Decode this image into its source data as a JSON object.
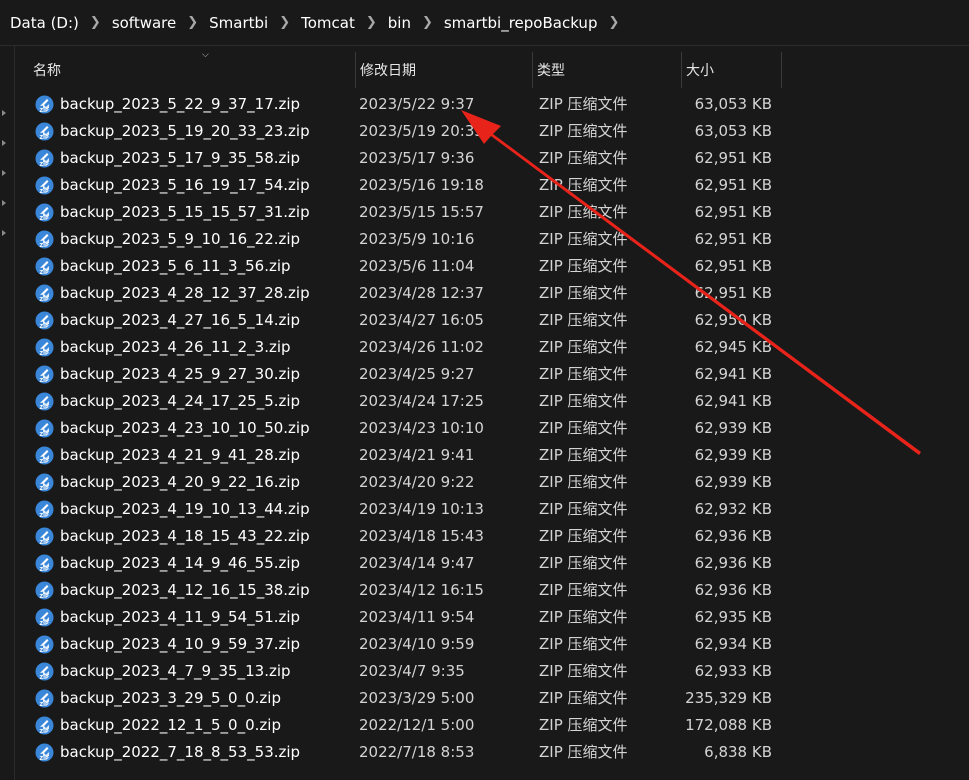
{
  "breadcrumb": [
    {
      "label": "Data (D:)"
    },
    {
      "label": "software"
    },
    {
      "label": "Smartbi"
    },
    {
      "label": "Tomcat"
    },
    {
      "label": "bin"
    },
    {
      "label": "smartbi_repoBackup"
    }
  ],
  "columns": {
    "name": "名称",
    "date": "修改日期",
    "type": "类型",
    "size": "大小"
  },
  "files": [
    {
      "name": "backup_2023_5_22_9_37_17.zip",
      "date": "2023/5/22 9:37",
      "type": "ZIP 压缩文件",
      "size": "63,053 KB"
    },
    {
      "name": "backup_2023_5_19_20_33_23.zip",
      "date": "2023/5/19 20:33",
      "type": "ZIP 压缩文件",
      "size": "63,053 KB"
    },
    {
      "name": "backup_2023_5_17_9_35_58.zip",
      "date": "2023/5/17 9:36",
      "type": "ZIP 压缩文件",
      "size": "62,951 KB"
    },
    {
      "name": "backup_2023_5_16_19_17_54.zip",
      "date": "2023/5/16 19:18",
      "type": "ZIP 压缩文件",
      "size": "62,951 KB"
    },
    {
      "name": "backup_2023_5_15_15_57_31.zip",
      "date": "2023/5/15 15:57",
      "type": "ZIP 压缩文件",
      "size": "62,951 KB"
    },
    {
      "name": "backup_2023_5_9_10_16_22.zip",
      "date": "2023/5/9 10:16",
      "type": "ZIP 压缩文件",
      "size": "62,951 KB"
    },
    {
      "name": "backup_2023_5_6_11_3_56.zip",
      "date": "2023/5/6 11:04",
      "type": "ZIP 压缩文件",
      "size": "62,951 KB"
    },
    {
      "name": "backup_2023_4_28_12_37_28.zip",
      "date": "2023/4/28 12:37",
      "type": "ZIP 压缩文件",
      "size": "62,951 KB"
    },
    {
      "name": "backup_2023_4_27_16_5_14.zip",
      "date": "2023/4/27 16:05",
      "type": "ZIP 压缩文件",
      "size": "62,950 KB"
    },
    {
      "name": "backup_2023_4_26_11_2_3.zip",
      "date": "2023/4/26 11:02",
      "type": "ZIP 压缩文件",
      "size": "62,945 KB"
    },
    {
      "name": "backup_2023_4_25_9_27_30.zip",
      "date": "2023/4/25 9:27",
      "type": "ZIP 压缩文件",
      "size": "62,941 KB"
    },
    {
      "name": "backup_2023_4_24_17_25_5.zip",
      "date": "2023/4/24 17:25",
      "type": "ZIP 压缩文件",
      "size": "62,941 KB"
    },
    {
      "name": "backup_2023_4_23_10_10_50.zip",
      "date": "2023/4/23 10:10",
      "type": "ZIP 压缩文件",
      "size": "62,939 KB"
    },
    {
      "name": "backup_2023_4_21_9_41_28.zip",
      "date": "2023/4/21 9:41",
      "type": "ZIP 压缩文件",
      "size": "62,939 KB"
    },
    {
      "name": "backup_2023_4_20_9_22_16.zip",
      "date": "2023/4/20 9:22",
      "type": "ZIP 压缩文件",
      "size": "62,939 KB"
    },
    {
      "name": "backup_2023_4_19_10_13_44.zip",
      "date": "2023/4/19 10:13",
      "type": "ZIP 压缩文件",
      "size": "62,932 KB"
    },
    {
      "name": "backup_2023_4_18_15_43_22.zip",
      "date": "2023/4/18 15:43",
      "type": "ZIP 压缩文件",
      "size": "62,936 KB"
    },
    {
      "name": "backup_2023_4_14_9_46_55.zip",
      "date": "2023/4/14 9:47",
      "type": "ZIP 压缩文件",
      "size": "62,936 KB"
    },
    {
      "name": "backup_2023_4_12_16_15_38.zip",
      "date": "2023/4/12 16:15",
      "type": "ZIP 压缩文件",
      "size": "62,936 KB"
    },
    {
      "name": "backup_2023_4_11_9_54_51.zip",
      "date": "2023/4/11 9:54",
      "type": "ZIP 压缩文件",
      "size": "62,935 KB"
    },
    {
      "name": "backup_2023_4_10_9_59_37.zip",
      "date": "2023/4/10 9:59",
      "type": "ZIP 压缩文件",
      "size": "62,934 KB"
    },
    {
      "name": "backup_2023_4_7_9_35_13.zip",
      "date": "2023/4/7 9:35",
      "type": "ZIP 压缩文件",
      "size": "62,933 KB"
    },
    {
      "name": "backup_2023_3_29_5_0_0.zip",
      "date": "2023/3/29 5:00",
      "type": "ZIP 压缩文件",
      "size": "235,329 KB"
    },
    {
      "name": "backup_2022_12_1_5_0_0.zip",
      "date": "2022/12/1 5:00",
      "type": "ZIP 压缩文件",
      "size": "172,088 KB"
    },
    {
      "name": "backup_2022_7_18_8_53_53.zip",
      "date": "2022/7/18 8:53",
      "type": "ZIP 压缩文件",
      "size": "6,838 KB"
    }
  ],
  "icons": {
    "file": "zip-file-icon",
    "separator": "chevron-right-icon",
    "sort": "chevron-down-icon",
    "annotation": "red-arrow"
  },
  "colors": {
    "background": "#191919",
    "annotation_arrow": "#e8231a",
    "zip_icon_blue": "#3a86d9"
  }
}
